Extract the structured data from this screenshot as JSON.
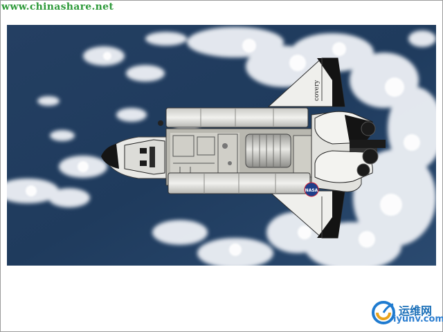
{
  "header": {
    "site_url": "www.chinashare.net"
  },
  "photo": {
    "orbiter_name_text": "covery",
    "insignia_text": "NASA",
    "colors": {
      "ocean": "#1f3f66",
      "clouds": "#f2f4f8",
      "hull": "#e9e9e6",
      "tiles": "#161616"
    }
  },
  "watermark": {
    "chinese_text": "运维网",
    "domain_text": "iyunv.com",
    "icon": "swirl-logo-icon"
  }
}
